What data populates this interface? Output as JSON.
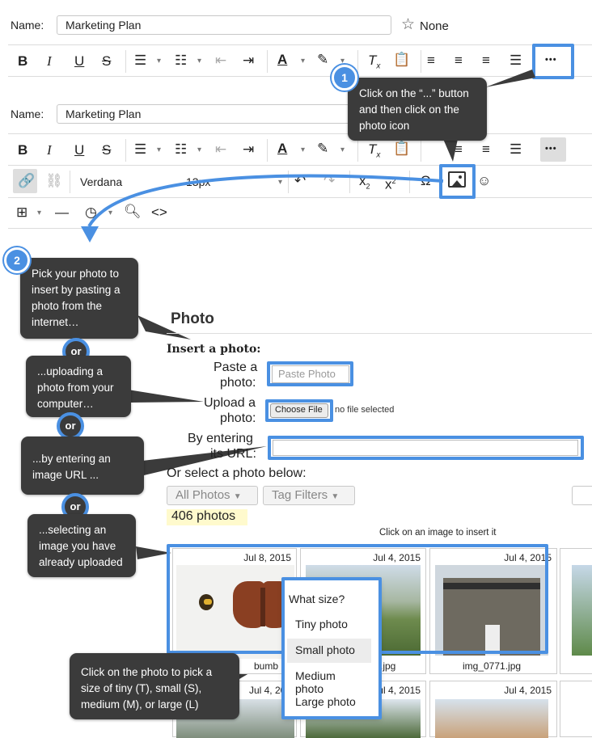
{
  "editor": {
    "name_label": "Name:",
    "name_value": "Marketing Plan",
    "star_label": "None"
  },
  "toolbar": {
    "bold": "B",
    "italic": "I",
    "underline": "U",
    "strike": "S",
    "more": "•••"
  },
  "toolbar2": {
    "font": "Verdana",
    "size": "13px"
  },
  "callouts": {
    "step1_badge": "1",
    "step1_text": "Click on the “...” button and then click on the photo icon",
    "step2_badge": "2",
    "step2_text": "Pick your photo to insert by pasting a photo from the internet…",
    "or": "or",
    "upload_text": "...uploading a photo from your computer…",
    "url_text": "...by entering an image URL ...",
    "select_text": "...selecting an image you have already uploaded",
    "size_text": "Click on the photo to pick a size of tiny (T), small (S), medium (M), or large (L)"
  },
  "photo_panel": {
    "title": "Photo",
    "insert_label": "Insert a photo:",
    "paste_label_1": "Paste a",
    "paste_label_2": "photo:",
    "paste_button": "Paste Photo",
    "upload_label_1": "Upload a",
    "upload_label_2": "photo:",
    "choose_file": "Choose File",
    "no_file": "no file selected",
    "url_label_1": "By entering",
    "url_label_2": "its URL:",
    "url_value": "",
    "select_label": "Or select a photo below:",
    "all_photos": "All Photos",
    "tag_filters": "Tag Filters",
    "count": "406 photos",
    "click_hint": "Click on an image to insert it"
  },
  "photos": [
    {
      "date": "Jul 8, 2015",
      "name": "bumb"
    },
    {
      "date": "Jul 4, 2015",
      "name": ".jpg"
    },
    {
      "date": "Jul 4, 2015",
      "name": "img_0771.jpg"
    },
    {
      "date": "Jul 4, 201",
      "name": ""
    },
    {
      "date": "Jul 4, 2015",
      "name": ""
    },
    {
      "date": "Jul 4, 2015",
      "name": ""
    }
  ],
  "size_menu": {
    "title": "What size?",
    "tiny": "Tiny photo",
    "small": "Small photo",
    "medium": "Medium photo",
    "large": "Large photo"
  },
  "colors": {
    "accent": "#4a90e2",
    "callout_bg": "#3b3b3b",
    "count_bg": "#fffacd"
  }
}
